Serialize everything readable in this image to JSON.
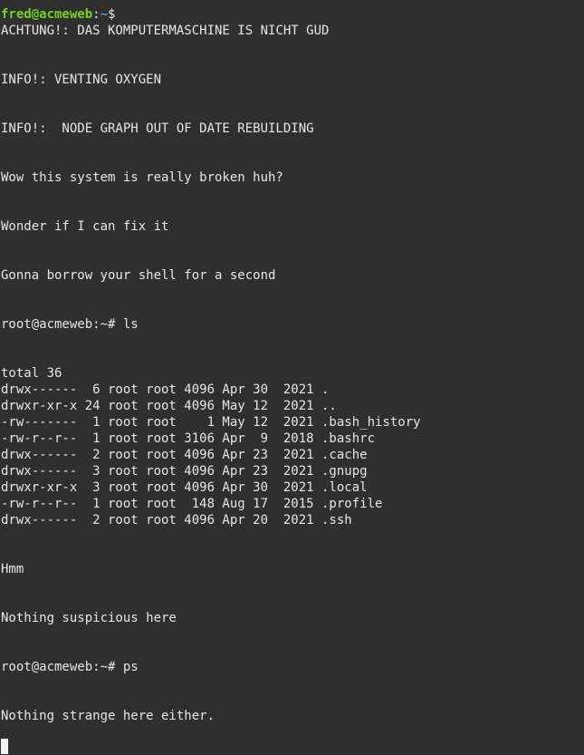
{
  "prompt_user": {
    "user_host": "fred@acmeweb",
    "separator": ":",
    "path": "~",
    "symbol": "$"
  },
  "output": {
    "l1": "ACHTUNG!: DAS KOMPUTERMASCHINE IS NICHT GUD",
    "l2": "INFO!: VENTING OXYGEN",
    "l3": "INFO!:  NODE GRAPH OUT OF DATE REBUILDING",
    "l4": "Wow this system is really broken huh?",
    "l5": "Wonder if I can fix it",
    "l6": "Gonna borrow your shell for a second",
    "l7": "root@acmeweb:~# ls",
    "l8": "total 36",
    "ls": [
      "drwx------  6 root root 4096 Apr 30  2021 .",
      "drwxr-xr-x 24 root root 4096 May 12  2021 ..",
      "-rw-------  1 root root    1 May 12  2021 .bash_history",
      "-rw-r--r--  1 root root 3106 Apr  9  2018 .bashrc",
      "drwx------  2 root root 4096 Apr 23  2021 .cache",
      "drwx------  3 root root 4096 Apr 23  2021 .gnupg",
      "drwxr-xr-x  3 root root 4096 Apr 30  2021 .local",
      "-rw-r--r--  1 root root  148 Aug 17  2015 .profile",
      "drwx------  2 root root 4096 Apr 20  2021 .ssh"
    ],
    "l9": "Hmm",
    "l10": "Nothing suspicious here",
    "l11": "root@acmeweb:~# ps",
    "l12": "Nothing strange here either."
  },
  "colors": {
    "background": "#2f2f2f",
    "text": "#e6e6e6",
    "prompt_user": "#75d01f",
    "prompt_path": "#5c93d6"
  }
}
